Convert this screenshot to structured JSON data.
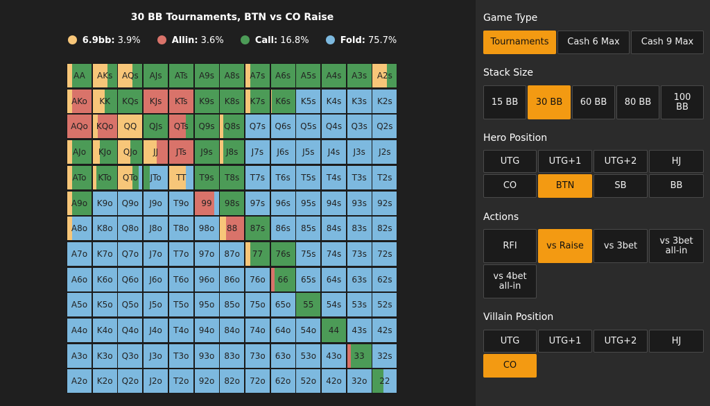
{
  "chart": {
    "title": "30 BB Tournaments, BTN vs CO Raise",
    "legend": [
      {
        "label": "6.9bb:",
        "value": "3.9%",
        "color": "#f7c679"
      },
      {
        "label": "Allin:",
        "value": "3.6%",
        "color": "#d9736a"
      },
      {
        "label": "Call:",
        "value": "16.8%",
        "color": "#4c9b57"
      },
      {
        "label": "Fold:",
        "value": "75.7%",
        "color": "#7db9df"
      }
    ],
    "colors": {
      "raise": "#f7c679",
      "allin": "#d9736a",
      "call": "#4c9b57",
      "fold": "#7db9df"
    },
    "hands": [
      [
        "AA",
        "AKs",
        "AQs",
        "AJs",
        "ATs",
        "A9s",
        "A8s",
        "A7s",
        "A6s",
        "A5s",
        "A4s",
        "A3s",
        "A2s"
      ],
      [
        "AKo",
        "KK",
        "KQs",
        "KJs",
        "KTs",
        "K9s",
        "K8s",
        "K7s",
        "K6s",
        "K5s",
        "K4s",
        "K3s",
        "K2s"
      ],
      [
        "AQo",
        "KQo",
        "QQ",
        "QJs",
        "QTs",
        "Q9s",
        "Q8s",
        "Q7s",
        "Q6s",
        "Q5s",
        "Q4s",
        "Q3s",
        "Q2s"
      ],
      [
        "AJo",
        "KJo",
        "QJo",
        "JJ",
        "JTs",
        "J9s",
        "J8s",
        "J7s",
        "J6s",
        "J5s",
        "J4s",
        "J3s",
        "J2s"
      ],
      [
        "ATo",
        "KTo",
        "QTo",
        "JTo",
        "TT",
        "T9s",
        "T8s",
        "T7s",
        "T6s",
        "T5s",
        "T4s",
        "T3s",
        "T2s"
      ],
      [
        "A9o",
        "K9o",
        "Q9o",
        "J9o",
        "T9o",
        "99",
        "98s",
        "97s",
        "96s",
        "95s",
        "94s",
        "93s",
        "92s"
      ],
      [
        "A8o",
        "K8o",
        "Q8o",
        "J8o",
        "T8o",
        "98o",
        "88",
        "87s",
        "86s",
        "85s",
        "84s",
        "83s",
        "82s"
      ],
      [
        "A7o",
        "K7o",
        "Q7o",
        "J7o",
        "T7o",
        "97o",
        "87o",
        "77",
        "76s",
        "75s",
        "74s",
        "73s",
        "72s"
      ],
      [
        "A6o",
        "K6o",
        "Q6o",
        "J6o",
        "T6o",
        "96o",
        "86o",
        "76o",
        "66",
        "65s",
        "64s",
        "63s",
        "62s"
      ],
      [
        "A5o",
        "K5o",
        "Q5o",
        "J5o",
        "T5o",
        "95o",
        "85o",
        "75o",
        "65o",
        "55",
        "54s",
        "53s",
        "52s"
      ],
      [
        "A4o",
        "K4o",
        "Q4o",
        "J4o",
        "T4o",
        "94o",
        "84o",
        "74o",
        "64o",
        "54o",
        "44",
        "43s",
        "42s"
      ],
      [
        "A3o",
        "K3o",
        "Q3o",
        "J3o",
        "T3o",
        "93o",
        "83o",
        "73o",
        "63o",
        "53o",
        "43o",
        "33",
        "32s"
      ],
      [
        "A2o",
        "K2o",
        "Q2o",
        "J2o",
        "T2o",
        "92o",
        "82o",
        "72o",
        "62o",
        "52o",
        "42o",
        "32o",
        "22"
      ]
    ],
    "mixes": [
      [
        [
          0.2,
          0,
          0.8,
          0
        ],
        [
          0.6,
          0,
          0.4,
          0
        ],
        [
          0.6,
          0,
          0.4,
          0
        ],
        [
          0,
          0,
          1,
          0
        ],
        [
          0,
          0,
          1,
          0
        ],
        [
          0,
          0,
          1,
          0
        ],
        [
          0,
          0,
          1,
          0
        ],
        [
          0.2,
          0,
          0.8,
          0
        ],
        [
          0,
          0,
          1,
          0
        ],
        [
          0,
          0,
          1,
          0
        ],
        [
          0,
          0,
          1,
          0
        ],
        [
          0,
          0,
          1,
          0
        ],
        [
          0.6,
          0,
          0.4,
          0
        ]
      ],
      [
        [
          0.2,
          0.8,
          0,
          0
        ],
        [
          0.5,
          0,
          0.5,
          0
        ],
        [
          0,
          0,
          1,
          0
        ],
        [
          0,
          1,
          0,
          0
        ],
        [
          0,
          1,
          0,
          0
        ],
        [
          0,
          0,
          1,
          0
        ],
        [
          0,
          0,
          1,
          0
        ],
        [
          0.2,
          0,
          0.8,
          0
        ],
        [
          0.05,
          0,
          0.95,
          0
        ],
        [
          0,
          0,
          0,
          1
        ],
        [
          0,
          0,
          0,
          1
        ],
        [
          0,
          0,
          0,
          1
        ],
        [
          0,
          0,
          0,
          1
        ]
      ],
      [
        [
          0,
          1,
          0,
          0
        ],
        [
          0.2,
          0.8,
          0,
          0
        ],
        [
          1,
          0,
          0,
          0
        ],
        [
          0,
          0,
          1,
          0
        ],
        [
          0,
          0.7,
          0.3,
          0
        ],
        [
          0,
          0,
          1,
          0
        ],
        [
          0.15,
          0,
          0.85,
          0
        ],
        [
          0,
          0,
          0,
          1
        ],
        [
          0,
          0,
          0,
          1
        ],
        [
          0,
          0,
          0,
          1
        ],
        [
          0,
          0,
          0,
          1
        ],
        [
          0,
          0,
          0,
          1
        ],
        [
          0,
          0,
          0,
          1
        ]
      ],
      [
        [
          0.2,
          0,
          0.8,
          0
        ],
        [
          0.3,
          0,
          0.7,
          0
        ],
        [
          0.5,
          0,
          0.5,
          0
        ],
        [
          0.55,
          0.45,
          0,
          0
        ],
        [
          0,
          1,
          0,
          0
        ],
        [
          0,
          0,
          1,
          0
        ],
        [
          0.15,
          0,
          0.85,
          0
        ],
        [
          0,
          0,
          0,
          1
        ],
        [
          0,
          0,
          0,
          1
        ],
        [
          0,
          0,
          0,
          1
        ],
        [
          0,
          0,
          0,
          1
        ],
        [
          0,
          0,
          0,
          1
        ],
        [
          0,
          0,
          0,
          1
        ]
      ],
      [
        [
          0.2,
          0,
          0.8,
          0
        ],
        [
          0.15,
          0,
          0.85,
          0
        ],
        [
          0.6,
          0,
          0.25,
          0.15
        ],
        [
          0,
          0,
          0.25,
          0.75
        ],
        [
          0.7,
          0,
          0,
          0.3
        ],
        [
          0,
          0,
          1,
          0
        ],
        [
          0,
          0,
          1,
          0
        ],
        [
          0,
          0,
          0,
          1
        ],
        [
          0,
          0,
          0,
          1
        ],
        [
          0,
          0,
          0,
          1
        ],
        [
          0,
          0,
          0,
          1
        ],
        [
          0,
          0,
          0,
          1
        ],
        [
          0,
          0,
          0,
          1
        ]
      ],
      [
        [
          0.2,
          0,
          0.8,
          0
        ],
        [
          0,
          0,
          0,
          1
        ],
        [
          0,
          0,
          0,
          1
        ],
        [
          0,
          0,
          0,
          1
        ],
        [
          0,
          0,
          0,
          1
        ],
        [
          0,
          0.8,
          0,
          0.2
        ],
        [
          0,
          0,
          1,
          0
        ],
        [
          0,
          0,
          0,
          1
        ],
        [
          0,
          0,
          0,
          1
        ],
        [
          0,
          0,
          0,
          1
        ],
        [
          0,
          0,
          0,
          1
        ],
        [
          0,
          0,
          0,
          1
        ],
        [
          0,
          0,
          0,
          1
        ]
      ],
      [
        [
          0.2,
          0,
          0,
          0.8
        ],
        [
          0,
          0,
          0,
          1
        ],
        [
          0,
          0,
          0,
          1
        ],
        [
          0,
          0,
          0,
          1
        ],
        [
          0,
          0,
          0,
          1
        ],
        [
          0,
          0,
          0,
          1
        ],
        [
          0.25,
          0.75,
          0,
          0
        ],
        [
          0,
          0,
          1,
          0
        ],
        [
          0,
          0,
          0,
          1
        ],
        [
          0,
          0,
          0,
          1
        ],
        [
          0,
          0,
          0,
          1
        ],
        [
          0,
          0,
          0,
          1
        ],
        [
          0,
          0,
          0,
          1
        ]
      ],
      [
        [
          0,
          0,
          0,
          1
        ],
        [
          0,
          0,
          0,
          1
        ],
        [
          0,
          0,
          0,
          1
        ],
        [
          0,
          0,
          0,
          1
        ],
        [
          0,
          0,
          0,
          1
        ],
        [
          0,
          0,
          0,
          1
        ],
        [
          0,
          0,
          0,
          1
        ],
        [
          0.2,
          0,
          0.8,
          0
        ],
        [
          0,
          0,
          1,
          0
        ],
        [
          0,
          0,
          0,
          1
        ],
        [
          0,
          0,
          0,
          1
        ],
        [
          0,
          0,
          0,
          1
        ],
        [
          0,
          0,
          0,
          1
        ]
      ],
      [
        [
          0,
          0,
          0,
          1
        ],
        [
          0,
          0,
          0,
          1
        ],
        [
          0,
          0,
          0,
          1
        ],
        [
          0,
          0,
          0,
          1
        ],
        [
          0,
          0,
          0,
          1
        ],
        [
          0,
          0,
          0,
          1
        ],
        [
          0,
          0,
          0,
          1
        ],
        [
          0,
          0,
          0,
          1
        ],
        [
          0,
          0.15,
          0.85,
          0
        ],
        [
          0,
          0,
          0,
          1
        ],
        [
          0,
          0,
          0,
          1
        ],
        [
          0,
          0,
          0,
          1
        ],
        [
          0,
          0,
          0,
          1
        ]
      ],
      [
        [
          0,
          0,
          0,
          1
        ],
        [
          0,
          0,
          0,
          1
        ],
        [
          0,
          0,
          0,
          1
        ],
        [
          0,
          0,
          0,
          1
        ],
        [
          0,
          0,
          0,
          1
        ],
        [
          0,
          0,
          0,
          1
        ],
        [
          0,
          0,
          0,
          1
        ],
        [
          0,
          0,
          0,
          1
        ],
        [
          0,
          0,
          0,
          1
        ],
        [
          0,
          0,
          1,
          0
        ],
        [
          0,
          0,
          0,
          1
        ],
        [
          0,
          0,
          0,
          1
        ],
        [
          0,
          0,
          0,
          1
        ]
      ],
      [
        [
          0,
          0,
          0,
          1
        ],
        [
          0,
          0,
          0,
          1
        ],
        [
          0,
          0,
          0,
          1
        ],
        [
          0,
          0,
          0,
          1
        ],
        [
          0,
          0,
          0,
          1
        ],
        [
          0,
          0,
          0,
          1
        ],
        [
          0,
          0,
          0,
          1
        ],
        [
          0,
          0,
          0,
          1
        ],
        [
          0,
          0,
          0,
          1
        ],
        [
          0,
          0,
          0,
          1
        ],
        [
          0,
          0,
          1,
          0
        ],
        [
          0,
          0,
          0,
          1
        ],
        [
          0,
          0,
          0,
          1
        ]
      ],
      [
        [
          0,
          0,
          0,
          1
        ],
        [
          0,
          0,
          0,
          1
        ],
        [
          0,
          0,
          0,
          1
        ],
        [
          0,
          0,
          0,
          1
        ],
        [
          0,
          0,
          0,
          1
        ],
        [
          0,
          0,
          0,
          1
        ],
        [
          0,
          0,
          0,
          1
        ],
        [
          0,
          0,
          0,
          1
        ],
        [
          0,
          0,
          0,
          1
        ],
        [
          0,
          0,
          0,
          1
        ],
        [
          0,
          0,
          0,
          1
        ],
        [
          0,
          0.15,
          0.85,
          0
        ],
        [
          0,
          0,
          0,
          1
        ]
      ],
      [
        [
          0,
          0,
          0,
          1
        ],
        [
          0,
          0,
          0,
          1
        ],
        [
          0,
          0,
          0,
          1
        ],
        [
          0,
          0,
          0,
          1
        ],
        [
          0,
          0,
          0,
          1
        ],
        [
          0,
          0,
          0,
          1
        ],
        [
          0,
          0,
          0,
          1
        ],
        [
          0,
          0,
          0,
          1
        ],
        [
          0,
          0,
          0,
          1
        ],
        [
          0,
          0,
          0,
          1
        ],
        [
          0,
          0,
          0,
          1
        ],
        [
          0,
          0,
          0,
          1
        ],
        [
          0,
          0,
          0.45,
          0.55
        ]
      ]
    ]
  },
  "sidebar": {
    "game_type": {
      "title": "Game Type",
      "options": [
        "Tournaments",
        "Cash 6 Max",
        "Cash 9 Max"
      ],
      "selected": "Tournaments"
    },
    "stack_size": {
      "title": "Stack Size",
      "options": [
        "15 BB",
        "30 BB",
        "60 BB",
        "80 BB",
        "100 BB"
      ],
      "selected": "30 BB"
    },
    "hero_position": {
      "title": "Hero Position",
      "options": [
        "UTG",
        "UTG+1",
        "UTG+2",
        "HJ",
        "CO",
        "BTN",
        "SB",
        "BB"
      ],
      "selected": "BTN"
    },
    "actions": {
      "title": "Actions",
      "options": [
        "RFI",
        "vs Raise",
        "vs 3bet",
        "vs 3bet all-in",
        "vs 4bet all-in"
      ],
      "selected": "vs Raise"
    },
    "villain_position": {
      "title": "Villain Position",
      "options": [
        "UTG",
        "UTG+1",
        "UTG+2",
        "HJ",
        "CO"
      ],
      "selected": "CO"
    }
  }
}
